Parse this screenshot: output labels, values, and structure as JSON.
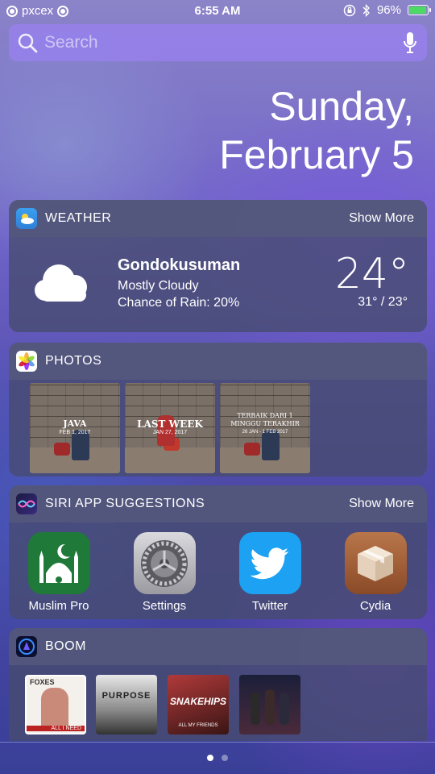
{
  "status_bar": {
    "carrier": "pxcex",
    "time": "6:55 AM",
    "battery": "96%",
    "battery_level": 0.96,
    "battery_color": "#4cd964"
  },
  "search": {
    "placeholder": "Search",
    "icon": "search-icon",
    "mic_icon": "microphone-icon"
  },
  "date": {
    "weekday": "Sunday,",
    "month_day": "February 5"
  },
  "weather": {
    "title": "WEATHER",
    "show_more": "Show More",
    "location": "Gondokusuman",
    "condition": "Mostly Cloudy",
    "rain": "Chance of Rain: 20%",
    "temp": "24°",
    "range": "31° / 23°",
    "icon": "cloud-icon"
  },
  "photos": {
    "title": "PHOTOS",
    "items": [
      {
        "title": "JAVA",
        "subtitle": "FEB 1, 2017"
      },
      {
        "title": "LAST WEEK",
        "subtitle": "JAN 27, 2017"
      },
      {
        "title": "TERBAIK DARI 1 MINGGU TERAKHIR",
        "subtitle": "26 JAN - 1 FEB 2017"
      }
    ]
  },
  "siri": {
    "title": "SIRI APP SUGGESTIONS",
    "show_more": "Show More",
    "apps": [
      {
        "name": "Muslim Pro",
        "color": "#1f7a3a",
        "icon": "mosque-icon"
      },
      {
        "name": "Settings",
        "color": "#8e8e93",
        "icon": "gear-icon"
      },
      {
        "name": "Twitter",
        "color": "#1da1f2",
        "icon": "bird-icon"
      },
      {
        "name": "Cydia",
        "color": "#a0603a",
        "icon": "box-icon"
      }
    ]
  },
  "boom": {
    "title": "BOOM",
    "albums": [
      {
        "label_top": "FOXES",
        "label_bottom": "ALL I NEED"
      },
      {
        "label_top": "PURPOSE",
        "label_bottom": ""
      },
      {
        "label_top": "SNAKEHIPS",
        "label_bottom": "ALL MY FRIENDS"
      },
      {
        "label_top": "",
        "label_bottom": ""
      }
    ]
  },
  "page_indicator": {
    "pages": 2,
    "current": 1
  }
}
